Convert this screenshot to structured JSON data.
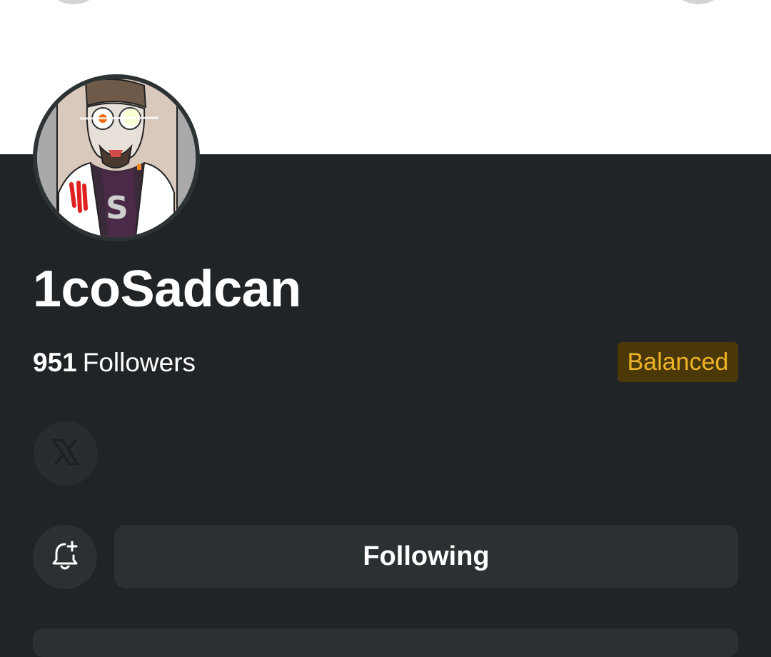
{
  "profile": {
    "username": "1coSadcan",
    "followers_count": "951",
    "followers_label": "Followers",
    "badge": "Balanced",
    "badge_bg": "#4a3808",
    "badge_color": "#f0b429"
  },
  "social": {
    "icon": "x-logo-icon"
  },
  "actions": {
    "notify_icon": "bell-plus-icon",
    "follow_label": "Following"
  },
  "colors": {
    "background": "#202426",
    "surface": "#2b3033",
    "text": "#ffffff"
  }
}
